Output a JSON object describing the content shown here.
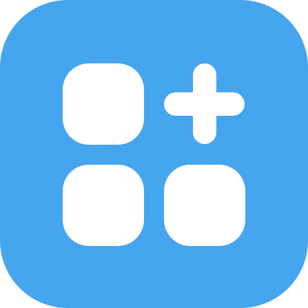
{
  "icon": {
    "name": "add-widget-icon",
    "background_color": "#45A5EF",
    "foreground_color": "#FFFFFF"
  }
}
